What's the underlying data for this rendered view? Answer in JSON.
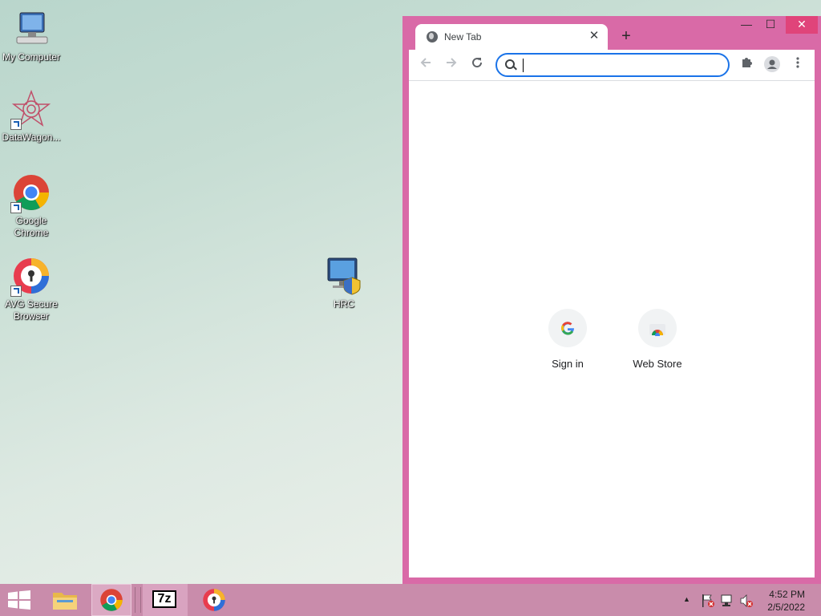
{
  "desktop": {
    "icons": [
      {
        "label": "My Computer"
      },
      {
        "label": "DataWagon..."
      },
      {
        "label": "Google Chrome"
      },
      {
        "label": "AVG Secure Browser"
      },
      {
        "label": "HRC"
      }
    ]
  },
  "browser": {
    "tab": {
      "title": "New Tab",
      "close": "✕"
    },
    "new_tab": "+",
    "window_controls": {
      "minimize": "—",
      "maximize": "☐",
      "close": "✕"
    },
    "omnibox": {
      "value": "",
      "placeholder": ""
    },
    "shortcuts": [
      {
        "label": "Sign in",
        "icon": "google-g-icon"
      },
      {
        "label": "Web Store",
        "icon": "chrome-web-store-icon"
      }
    ],
    "colors": {
      "frame": "#d96aa7",
      "accent": "#1a73e8"
    }
  },
  "taskbar": {
    "apps": [
      {
        "name": "file-explorer-icon"
      },
      {
        "name": "chrome-icon"
      },
      {
        "name": "7zip-icon",
        "text": "7z"
      },
      {
        "name": "avg-browser-icon"
      }
    ],
    "clock": {
      "time": "4:52 PM",
      "date": "2/5/2022"
    },
    "tray": {
      "expand": "▲"
    }
  }
}
